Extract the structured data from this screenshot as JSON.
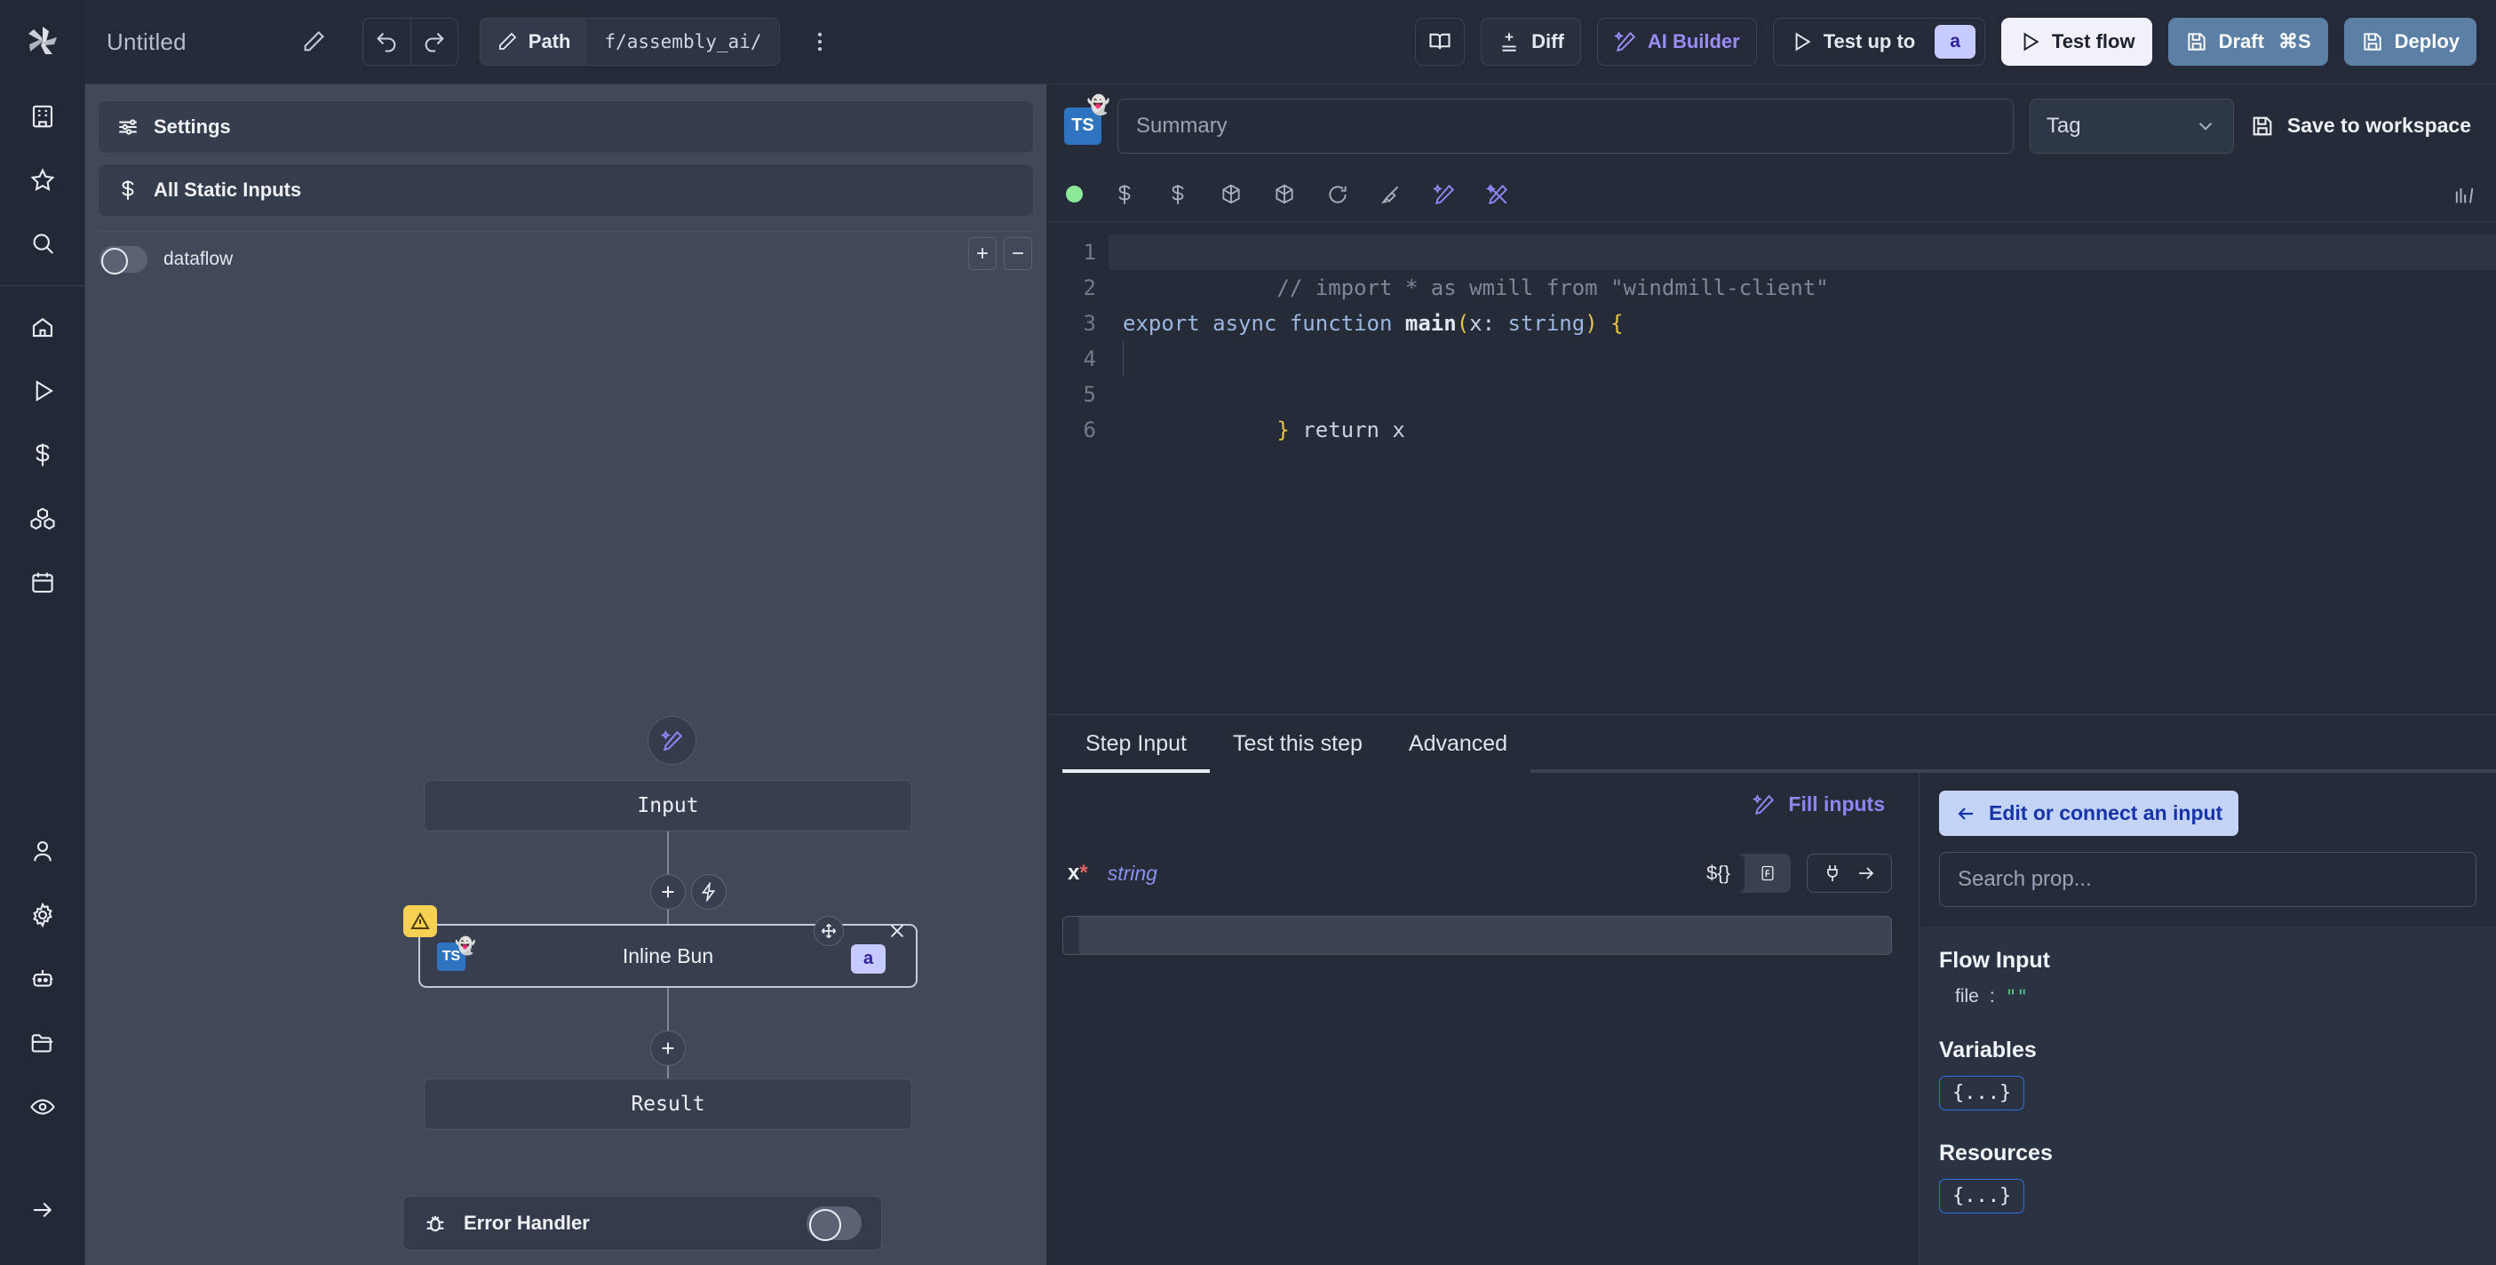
{
  "topbar": {
    "logo_icon": "windmill-logo-icon",
    "title": "Untitled",
    "edit_title_icon": "pencil-icon",
    "undo_icon": "undo-arrow-icon",
    "redo_icon": "redo-arrow-icon",
    "path_label": "Path",
    "path_value": "f/assembly_ai/",
    "path_icon": "pencil-icon",
    "kebab_icon": "vertical-dots-icon",
    "book_icon": "book-open-icon",
    "diff_label": "Diff",
    "diff_icon": "diff-icon",
    "ai_builder_label": "AI Builder",
    "ai_builder_icon": "wand-sparkles-icon",
    "test_up_to_label": "Test up to",
    "test_up_to_badge": "a",
    "test_up_to_icon": "play-triangle-icon",
    "test_flow_label": "Test flow",
    "test_flow_icon": "play-triangle-icon",
    "draft_label": "Draft",
    "draft_shortcut": "⌘S",
    "draft_icon": "save-icon",
    "deploy_label": "Deploy",
    "deploy_icon": "save-icon"
  },
  "rail": {
    "items": [
      {
        "icon": "building-icon",
        "name": "workspace"
      },
      {
        "icon": "star-icon",
        "name": "favorites"
      },
      {
        "icon": "search-icon",
        "name": "search"
      },
      {
        "icon": "home-icon",
        "name": "home"
      },
      {
        "icon": "play-triangle-icon",
        "name": "runs"
      },
      {
        "icon": "dollar-icon",
        "name": "variables"
      },
      {
        "icon": "boxes-icon",
        "name": "resources"
      },
      {
        "icon": "calendar-icon",
        "name": "schedules"
      },
      {
        "icon": "user-icon",
        "name": "account"
      },
      {
        "icon": "gear-icon",
        "name": "settings"
      },
      {
        "icon": "robot-icon",
        "name": "workers"
      },
      {
        "icon": "folder-icon",
        "name": "folders"
      },
      {
        "icon": "eye-icon",
        "name": "audit-logs"
      },
      {
        "icon": "arrow-right-icon",
        "name": "expand-sidebar"
      }
    ]
  },
  "canvas": {
    "settings_label": "Settings",
    "settings_icon": "sliders-icon",
    "static_inputs_label": "All Static Inputs",
    "static_inputs_icon": "dollar-icon",
    "flow_mode_label": "dataflow",
    "zoom_in_label": "+",
    "zoom_out_label": "−",
    "ai_node_icon": "wand-sparkles-icon",
    "nodes": {
      "input_label": "Input",
      "step_label": "Inline Bun",
      "step_lang_badge": "TS",
      "step_tag_badge": "a",
      "step_warning_icon": "warning-triangle-icon",
      "step_move_icon": "move-icon",
      "step_close_icon": "close-icon",
      "result_label": "Result"
    },
    "add_step_icon": "plus-circle-icon",
    "branch_icon": "bolt-icon",
    "error_handler_label": "Error Handler",
    "error_handler_icon": "bug-icon",
    "error_handler_enabled": false
  },
  "editor": {
    "lang_badge": "TS",
    "summary_placeholder": "Summary",
    "summary_value": "",
    "tag_label": "Tag",
    "tag_chevron_icon": "chevron-down-icon",
    "save_workspace_label": "Save to workspace",
    "save_workspace_icon": "save-icon",
    "toolbar_icons": [
      "status-dot-green",
      "dollar-icon",
      "dollar-icon",
      "package-icon",
      "package-icon",
      "refresh-icon",
      "broom-icon",
      "wand-sparkles-icon",
      "wand-sparkles-off-icon"
    ],
    "right_icon": "bar-chart-icon",
    "code_lines": [
      {
        "n": "1",
        "active": true
      },
      {
        "n": "2",
        "active": false
      },
      {
        "n": "3",
        "active": false
      },
      {
        "n": "4",
        "active": false
      },
      {
        "n": "5",
        "active": false
      },
      {
        "n": "6",
        "active": false
      }
    ],
    "code": {
      "line1_comment": "// import * as wmill from \"windmill-client\"",
      "line3_kw": "export async function ",
      "line3_fn": "main",
      "line3_paren_open": "(",
      "line3_param": "x: ",
      "line3_type": "string",
      "line3_paren_close": ")",
      "line3_brace": " {",
      "line4": "  return x",
      "line5": "}"
    }
  },
  "bottom": {
    "tabs": [
      {
        "label": "Step Input",
        "active": true
      },
      {
        "label": "Test this step",
        "active": false
      },
      {
        "label": "Advanced",
        "active": false
      }
    ],
    "fill_inputs_label": "Fill inputs",
    "fill_inputs_icon": "wand-sparkles-icon",
    "prop_name": "x",
    "prop_required_mark": "*",
    "prop_type": "string",
    "seg_static_label": "${}",
    "seg_fx_label": "ƒ",
    "connect_icon": "plug-icon",
    "connect_arrow_icon": "arrow-right-icon",
    "prop_value": ""
  },
  "props_panel": {
    "edit_connect_label": "Edit or connect an input",
    "edit_connect_icon": "arrow-left-icon",
    "search_placeholder": "Search prop...",
    "search_value": "",
    "sections": [
      {
        "title": "Flow Input",
        "items": [
          {
            "key": "file",
            "sep": ":",
            "value": "\"\""
          }
        ],
        "chip": null
      },
      {
        "title": "Variables",
        "items": [],
        "chip": "{...}"
      },
      {
        "title": "Resources",
        "items": [],
        "chip": "{...}"
      }
    ]
  }
}
